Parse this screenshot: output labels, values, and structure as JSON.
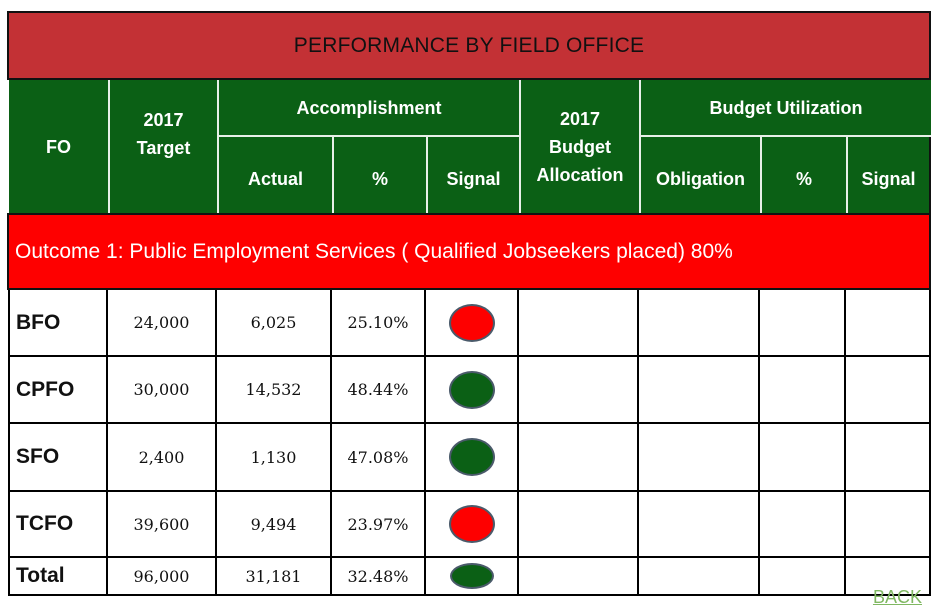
{
  "title": "PERFORMANCE BY FIELD OFFICE",
  "headers": {
    "fo": "FO",
    "target": "2017 Target",
    "accomplishment": "Accomplishment",
    "actual": "Actual",
    "pct": "%",
    "signal": "Signal",
    "budget_allocation": "2017 Budget Allocation",
    "budget_utilization": "Budget Utilization",
    "obligation": "Obligation",
    "bu_pct": "%",
    "bu_signal": "Signal"
  },
  "outcome": "Outcome 1: Public Employment Services ( Qualified Jobseekers placed) 80%",
  "signal_colors": {
    "red": "#fe0000",
    "green": "#0b6015"
  },
  "rows": [
    {
      "fo": "BFO",
      "target": "24,000",
      "actual": "6,025",
      "pct": "25.10%",
      "signal": "red",
      "allocation": "",
      "obligation": "",
      "bu_pct": "",
      "bu_signal": ""
    },
    {
      "fo": "CPFO",
      "target": "30,000",
      "actual": "14,532",
      "pct": "48.44%",
      "signal": "green",
      "allocation": "",
      "obligation": "",
      "bu_pct": "",
      "bu_signal": ""
    },
    {
      "fo": "SFO",
      "target": "2,400",
      "actual": "1,130",
      "pct": "47.08%",
      "signal": "green",
      "allocation": "",
      "obligation": "",
      "bu_pct": "",
      "bu_signal": ""
    },
    {
      "fo": "TCFO",
      "target": "39,600",
      "actual": "9,494",
      "pct": "23.97%",
      "signal": "red",
      "allocation": "",
      "obligation": "",
      "bu_pct": "",
      "bu_signal": ""
    },
    {
      "fo": "Total",
      "target": "96,000",
      "actual": "31,181",
      "pct": "32.48%",
      "signal": "green",
      "allocation": "",
      "obligation": "",
      "bu_pct": "",
      "bu_signal": ""
    }
  ],
  "back_link": "BACK"
}
